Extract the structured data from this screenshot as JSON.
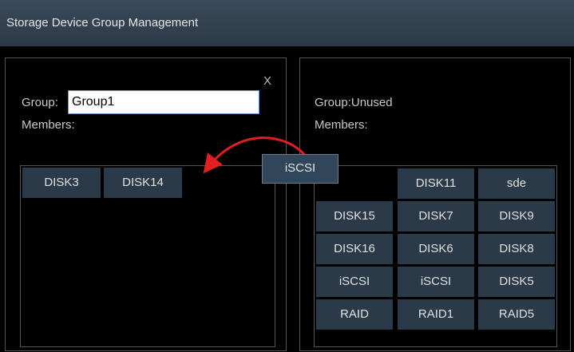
{
  "window": {
    "title": "Storage Device Group Management"
  },
  "left_panel": {
    "close_label": "X",
    "group_label": "Group:",
    "group_value": "Group1",
    "members_label": "Members:",
    "members": [
      "DISK3",
      "DISK14"
    ]
  },
  "right_panel": {
    "group_label": "Group:Unused",
    "members_label": "Members:",
    "columns": [
      [
        "DISK15",
        "DISK16",
        "iSCSI",
        "RAID"
      ],
      [
        "DISK11",
        "DISK7",
        "DISK6",
        "iSCSI",
        "RAID1"
      ],
      [
        "sde",
        "DISK9",
        "DISK8",
        "DISK5",
        "RAID5"
      ]
    ]
  },
  "drag": {
    "label": "iSCSI",
    "arrow_color": "#e02020"
  }
}
